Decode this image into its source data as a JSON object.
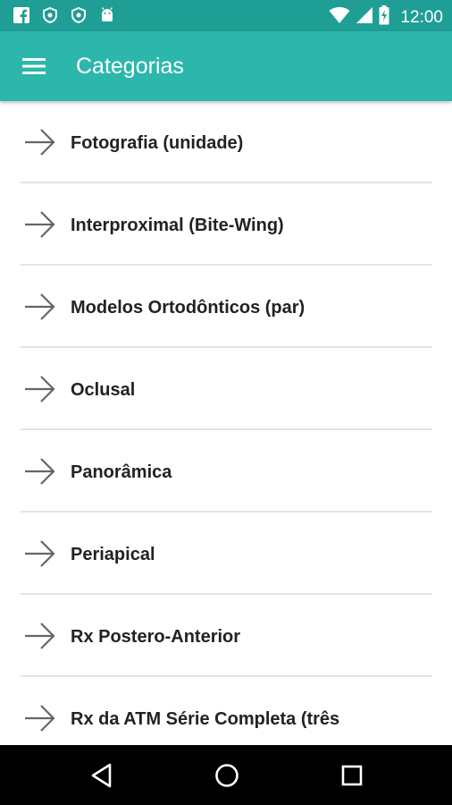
{
  "status_bar": {
    "time": "12:00",
    "left_icons": [
      "facebook-icon",
      "shield-icon",
      "shield-icon",
      "android-icon"
    ],
    "right_icons": [
      "wifi-icon",
      "signal-icon",
      "battery-charging-icon"
    ]
  },
  "app_bar": {
    "title": "Categorias",
    "menu_icon": "menu-icon",
    "color": "#2db7ac"
  },
  "categories": [
    {
      "label": "Fotografia (unidade)"
    },
    {
      "label": "Interproximal (Bite-Wing)"
    },
    {
      "label": "Modelos Ortodônticos (par)"
    },
    {
      "label": "Oclusal"
    },
    {
      "label": "Panorâmica"
    },
    {
      "label": "Periapical"
    },
    {
      "label": "Rx Postero-Anterior"
    },
    {
      "label": "Rx da ATM Série Completa (três"
    }
  ],
  "nav_bar": {
    "buttons": [
      "back-icon",
      "home-icon",
      "recents-icon"
    ]
  }
}
